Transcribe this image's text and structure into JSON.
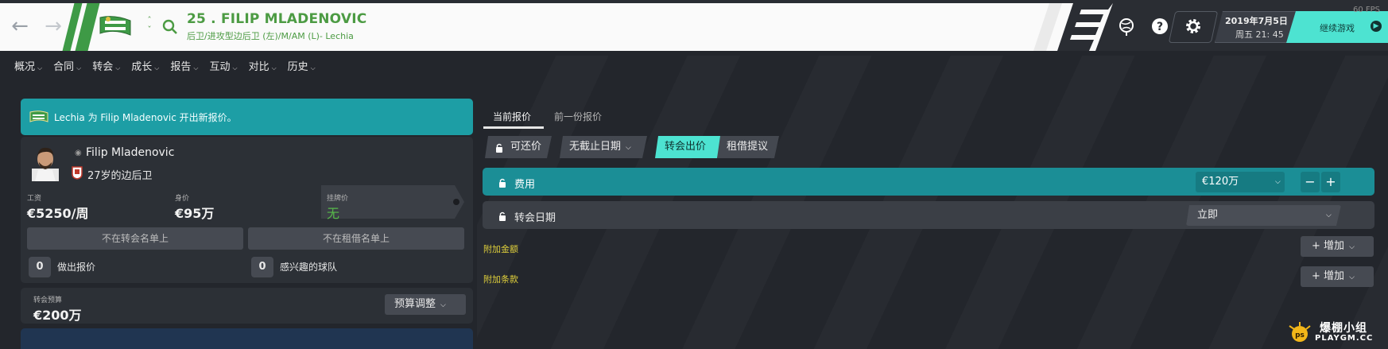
{
  "header": {
    "player_title": "25 . FILIP MLADENOVIC",
    "player_subtitle": "后卫/进攻型边后卫 (左)/M/AM (L)- Lechia",
    "date": "2019年7月5日",
    "time": "周五 21: 45",
    "continue_label": "继续游戏",
    "fps": "60 FPS",
    "accent_color": "#4de3d1",
    "club_color": "#3e9a46"
  },
  "menu": [
    {
      "label": "概况"
    },
    {
      "label": "合同"
    },
    {
      "label": "转会"
    },
    {
      "label": "成长"
    },
    {
      "label": "报告"
    },
    {
      "label": "互动"
    },
    {
      "label": "对比"
    },
    {
      "label": "历史"
    }
  ],
  "notice": {
    "text": "Lechia 为 Filip Mladenovic 开出新报价。"
  },
  "player": {
    "name": "Filip Mladenovic",
    "age_position": "27岁的边后卫",
    "wage_label": "工资",
    "wage_value": "€5250/周",
    "value_label": "身价",
    "value_value": "€95万",
    "asking_label": "挂牌价",
    "asking_value": "无",
    "transfer_list_status": "不在转会名单上",
    "loan_list_status": "不在租借名单上",
    "bids_count": "0",
    "bids_label": "做出报价",
    "interested_count": "0",
    "interested_label": "感兴趣的球队"
  },
  "budget": {
    "label": "转会预算",
    "value": "€200万",
    "adjust_button": "预算调整"
  },
  "offer": {
    "tabs": [
      "当前报价",
      "前一份报价"
    ],
    "negotiable": "可还价",
    "no_deadline": "无截止日期",
    "transfer_offer": "转会出价",
    "loan_offer": "租借提议",
    "fee_label": "费用",
    "fee_value": "€120万",
    "minus": "−",
    "plus": "+",
    "transfer_date_label": "转会日期",
    "transfer_date_value": "立即",
    "additional_fees": "附加金额",
    "additional_clauses": "附加条款",
    "add_label": "增加"
  },
  "watermark": {
    "line1": "爆棚小组",
    "line2": "PLAYGM.CC"
  }
}
